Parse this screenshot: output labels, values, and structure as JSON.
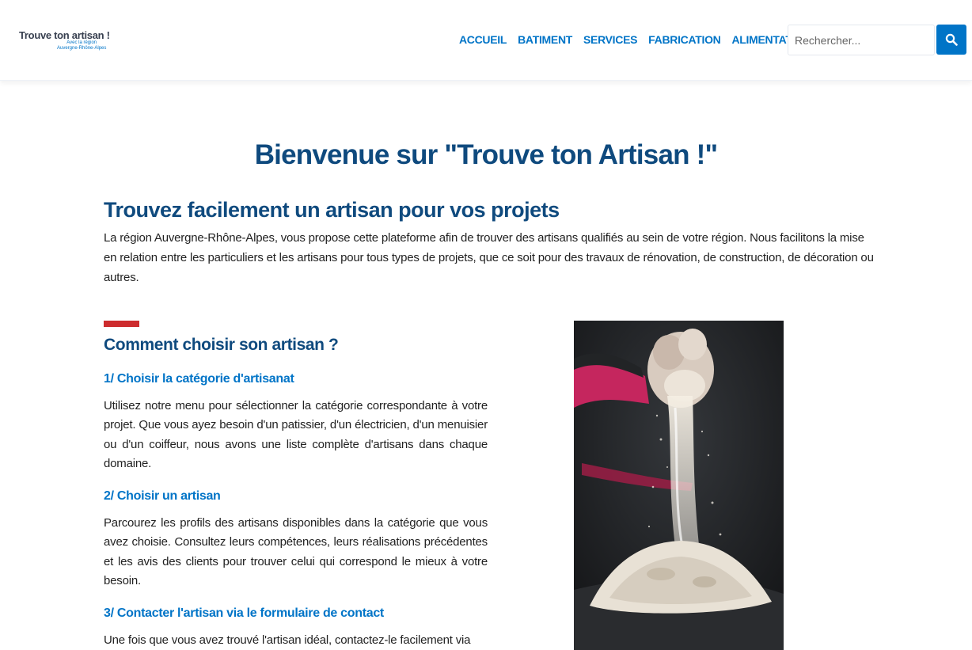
{
  "header": {
    "logo": {
      "main": "Trouve ton artisan !",
      "sub_line1": "Avec la région",
      "sub_line2": "Auvergne-Rhône-Alpes"
    },
    "nav": [
      "ACCUEIL",
      "BATIMENT",
      "SERVICES",
      "FABRICATION",
      "ALIMENTATION"
    ],
    "search": {
      "placeholder": "Rechercher...",
      "value": "",
      "icon": "search-icon"
    }
  },
  "main": {
    "title": "Bienvenue sur \"Trouve ton Artisan !\"",
    "subtitle": "Trouvez facilement un artisan pour vos projets",
    "intro": "La région Auvergne-Rhône-Alpes, vous propose cette plateforme afin de trouver des artisans qualifiés au sein de votre région. Nous facilitons la mise en relation entre les particuliers et les artisans pour tous types de projets, que ce soit pour des travaux de rénovation, de construction, de décoration ou autres.",
    "how_title": "Comment choisir son artisan ?",
    "steps": [
      {
        "title": "1/ Choisir la catégorie d'artisanat",
        "text": "Utilisez notre menu pour sélectionner la catégorie correspondante à votre projet. Que vous ayez besoin d'un patissier, d'un électricien, d'un menuisier ou d'un coiffeur, nous avons une liste complète d'artisans dans chaque domaine."
      },
      {
        "title": "2/ Choisir un artisan",
        "text": "Parcourez les profils des artisans disponibles dans la catégorie que vous avez choisie. Consultez leurs compétences, leurs réalisations précédentes et les avis des clients pour trouver celui qui correspond le mieux à votre besoin."
      },
      {
        "title": "3/ Contacter l'artisan via le formulaire de contact",
        "text": "Une fois que vous avez trouvé l'artisan idéal, contactez-le facilement via"
      }
    ]
  },
  "colors": {
    "accent": "#0074c7",
    "title": "#0f4a7e",
    "red_bar": "#cd2c2e"
  }
}
